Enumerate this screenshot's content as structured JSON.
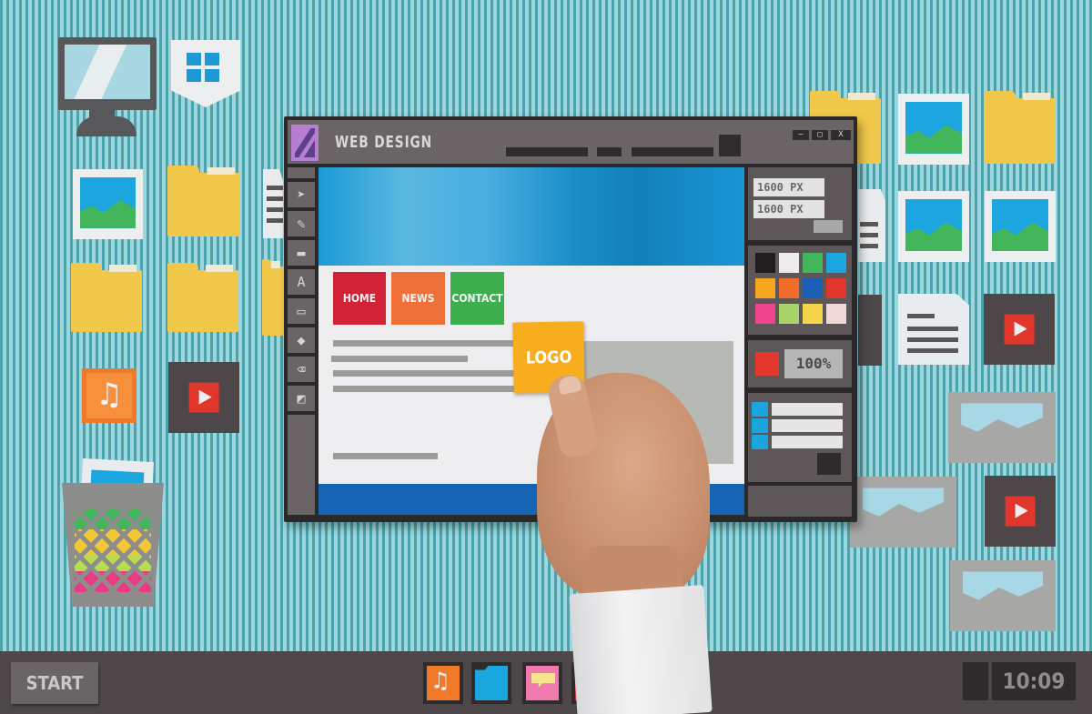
{
  "window": {
    "title": "WEB DESIGN",
    "controls": {
      "minimize": "—",
      "maximize": "▢",
      "close": "X"
    }
  },
  "toolbox": {
    "tools": [
      {
        "name": "select",
        "glyph": "➤"
      },
      {
        "name": "brush",
        "glyph": "✎"
      },
      {
        "name": "rectangle-fill",
        "glyph": "▬"
      },
      {
        "name": "text",
        "glyph": "A"
      },
      {
        "name": "rectangle",
        "glyph": "▭"
      },
      {
        "name": "fill",
        "glyph": "◆"
      },
      {
        "name": "eraser",
        "glyph": "⌫"
      },
      {
        "name": "color-swap",
        "glyph": "◩"
      }
    ]
  },
  "canvas": {
    "nav": [
      {
        "label": "HOME",
        "color": "#d02336"
      },
      {
        "label": "NEWS",
        "color": "#f0703a"
      },
      {
        "label": "CONTACT",
        "color": "#3cae4e"
      }
    ],
    "logo_card": "LOGO"
  },
  "properties": {
    "width": "1600 PX",
    "height": "1600 PX",
    "zoom": "100%",
    "swatches": [
      "#1f1d1e",
      "#ececee",
      "#43b55a",
      "#1ca6e0",
      "#f6a51c",
      "#f06e2a",
      "#1a5fb4",
      "#e0362b",
      "#f0448c",
      "#a9d46a",
      "#f7d54a",
      "#f0d8d8"
    ],
    "active_color": "#e1372c"
  },
  "desktop": {
    "icons": [
      "monitor",
      "shield",
      "image",
      "folder",
      "folder",
      "folder",
      "music",
      "video",
      "trash",
      "folder",
      "image",
      "folder",
      "document",
      "image",
      "image",
      "document",
      "video",
      "image-gray",
      "image-gray",
      "video",
      "image-gray"
    ]
  },
  "taskbar": {
    "start_label": "START",
    "apps": [
      {
        "name": "music",
        "color": "#f07a2a"
      },
      {
        "name": "folder",
        "color": "#1aa7df"
      },
      {
        "name": "chat",
        "color": "#f07ab0"
      },
      {
        "name": "video",
        "color": "#d0352b"
      }
    ],
    "clock": "10:09"
  }
}
